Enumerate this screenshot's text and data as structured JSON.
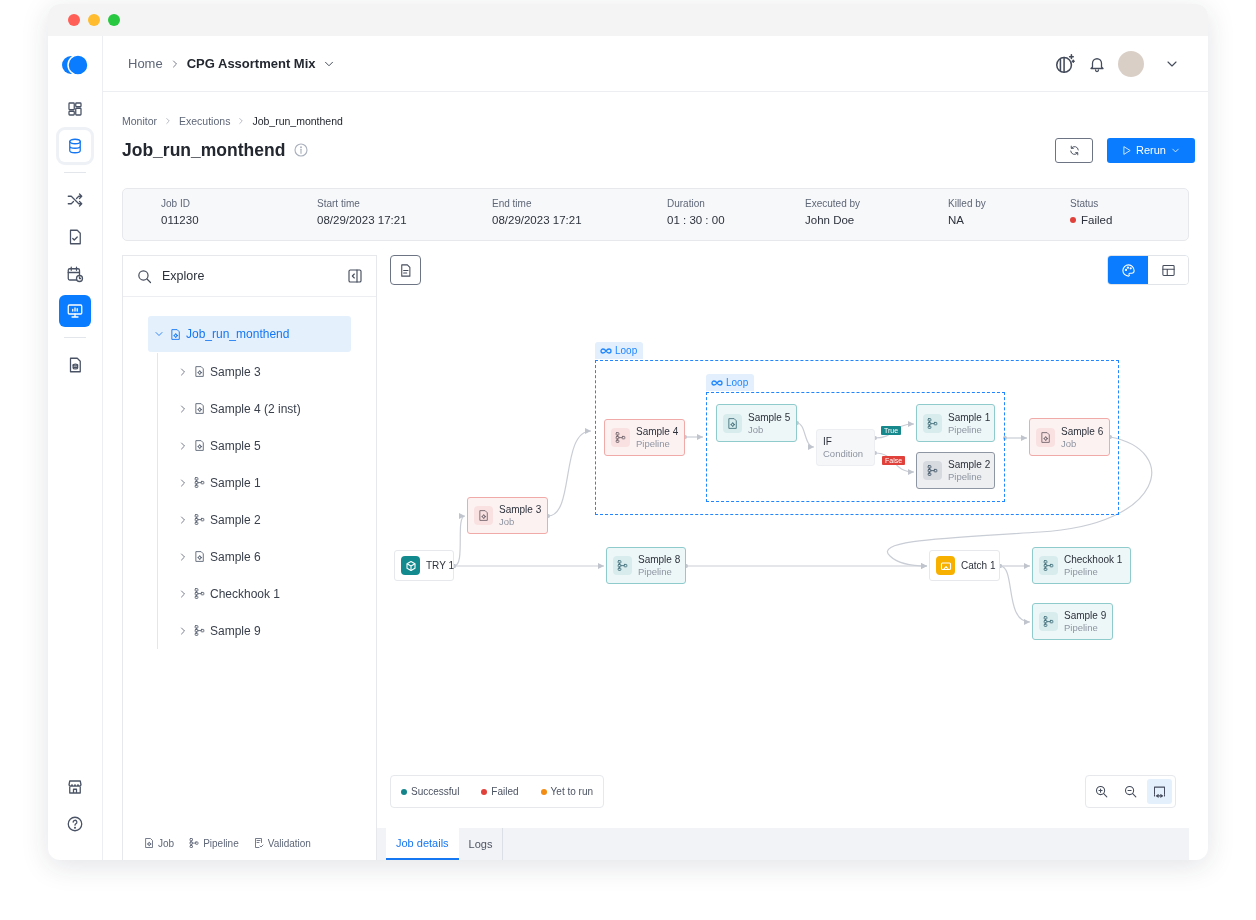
{
  "window": {
    "controls": [
      {
        "color": "#ff5f57"
      },
      {
        "color": "#febc2e"
      },
      {
        "color": "#28c840"
      }
    ]
  },
  "sidebar": {
    "top_items": [
      {
        "kind": "dashboard",
        "selected": false
      },
      {
        "kind": "database",
        "selected": false,
        "hovered": true
      },
      {
        "kind": "shuffle",
        "selected": false
      },
      {
        "kind": "checklist",
        "selected": false
      },
      {
        "kind": "calendar",
        "selected": false
      },
      {
        "kind": "monitor",
        "selected": true
      },
      {
        "kind": "document",
        "selected": false
      }
    ],
    "bottom_items": [
      {
        "kind": "store",
        "selected": false
      },
      {
        "kind": "help",
        "selected": false
      }
    ]
  },
  "header": {
    "breadcrumb": [
      {
        "text": "Home",
        "current": false
      },
      {
        "text": "CPG Assortment Mix",
        "current": true
      }
    ]
  },
  "page": {
    "breadcrumb": [
      "Monitor",
      "Executions",
      "Job_run_monthend"
    ],
    "title": "Job_run_monthend",
    "primary_button": "Rerun"
  },
  "details": [
    {
      "label": "Job ID",
      "value": "011230"
    },
    {
      "label": "Start time",
      "value": "08/29/2023 17:21"
    },
    {
      "label": "End time",
      "value": "08/29/2023 17:21"
    },
    {
      "label": "Duration",
      "value": "01 : 30 : 00"
    },
    {
      "label": "Executed by",
      "value": "John Doe"
    },
    {
      "label": "Killed by",
      "value": "NA"
    },
    {
      "label": "Status",
      "value": "Failed",
      "color": "#e0413a"
    }
  ],
  "explorer": {
    "title": "Explore",
    "tree": [
      {
        "label": "Job_run_monthend",
        "kind": "job",
        "expanded": true,
        "selected": true,
        "children": [
          {
            "label": "Sample 3",
            "kind": "job",
            "expanded": false,
            "selected": false
          },
          {
            "label": "Sample 4 (2 inst)",
            "kind": "job",
            "expanded": false,
            "selected": false
          },
          {
            "label": "Sample 5",
            "kind": "job",
            "expanded": false,
            "selected": false
          },
          {
            "label": "Sample 1",
            "kind": "pipeline",
            "expanded": false,
            "selected": false
          },
          {
            "label": "Sample 2",
            "kind": "pipeline",
            "expanded": false,
            "selected": false
          },
          {
            "label": "Sample 6",
            "kind": "job",
            "expanded": false,
            "selected": false
          },
          {
            "label": "Checkhook 1",
            "kind": "pipeline",
            "expanded": false,
            "selected": false
          },
          {
            "label": "Sample 9",
            "kind": "pipeline",
            "expanded": false,
            "selected": false
          }
        ]
      }
    ],
    "key": [
      {
        "kind": "job",
        "label": "Job"
      },
      {
        "kind": "pipeline",
        "label": "Pipeline"
      },
      {
        "kind": "validation",
        "label": "Validation"
      }
    ]
  },
  "view_toggle": [
    {
      "kind": "diagram",
      "selected": true
    },
    {
      "kind": "table",
      "selected": false
    }
  ],
  "diagram": {
    "loops": [
      {
        "label": "Loop"
      },
      {
        "label": "Loop"
      }
    ],
    "nodes": [
      {
        "kind": "try",
        "name": "TRY 1"
      },
      {
        "kind": "job",
        "name": "Sample 3",
        "type": "Job",
        "color": "#f0aaa8"
      },
      {
        "kind": "pipeline",
        "name": "Sample 4",
        "type": "Pipeline",
        "color": "#f0aaa8"
      },
      {
        "kind": "job",
        "name": "Sample 5",
        "type": "Job",
        "color": "#8fcacd"
      },
      {
        "kind": "condition",
        "name": "IF",
        "type": "Condition"
      },
      {
        "kind": "pipeline",
        "name": "Sample 1",
        "type": "Pipeline",
        "color": "#8fcacd"
      },
      {
        "kind": "pipeline",
        "name": "Sample 2",
        "type": "Pipeline",
        "color": "#8e95a3"
      },
      {
        "kind": "job",
        "name": "Sample 6",
        "type": "Job",
        "color": "#f0aaa8"
      },
      {
        "kind": "pipeline",
        "name": "Sample 8",
        "type": "Pipeline",
        "color": "#8fcacd"
      },
      {
        "kind": "catch",
        "name": "Catch 1"
      },
      {
        "kind": "pipeline",
        "name": "Checkhook 1",
        "type": "Pipeline",
        "color": "#8fcacd"
      },
      {
        "kind": "pipeline",
        "name": "Sample 9",
        "type": "Pipeline",
        "color": "#8fcacd"
      }
    ],
    "branch_labels": [
      {
        "text": "True",
        "color": "#17898d"
      },
      {
        "text": "False",
        "color": "#e0413a"
      }
    ]
  },
  "legend": [
    {
      "label": "Successful",
      "color": "#13858a"
    },
    {
      "label": "Failed",
      "color": "#e0413a"
    },
    {
      "label": "Yet to run",
      "color": "#f28c13"
    }
  ],
  "zoom_controls": [
    {
      "kind": "zoom-in",
      "selected": false
    },
    {
      "kind": "zoom-out",
      "selected": false
    },
    {
      "kind": "fit",
      "selected": true
    }
  ],
  "bottom_tabs": [
    {
      "label": "Job details",
      "selected": true
    },
    {
      "label": "Logs",
      "selected": false
    }
  ]
}
